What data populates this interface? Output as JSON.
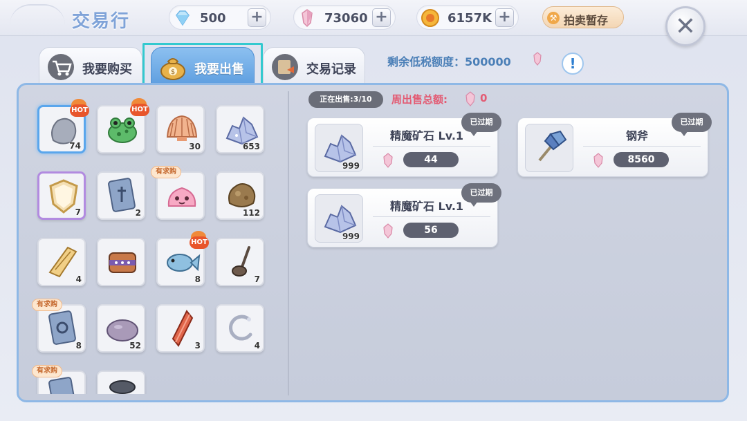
{
  "header": {
    "title": "交易行",
    "currencies": [
      {
        "name": "diamond",
        "icon": "diamond-icon",
        "value": "500"
      },
      {
        "name": "crystal",
        "icon": "crystal-icon",
        "value": "73060"
      },
      {
        "name": "coin",
        "icon": "coin-icon",
        "value": "6157K"
      }
    ],
    "plus_label": "+",
    "auction_label": "拍卖暂存",
    "close_label": "✕"
  },
  "tabs": [
    {
      "label": "我要购买",
      "icon": "cart-icon",
      "active": false
    },
    {
      "label": "我要出售",
      "icon": "money-bag-icon",
      "active": true
    },
    {
      "label": "交易记录",
      "icon": "record-book-icon",
      "active": false
    }
  ],
  "quota": {
    "label": "剩余低税额度：500000",
    "info": "!"
  },
  "inventory": [
    {
      "icon": "stone-icon",
      "count": "74",
      "hot": "HOT",
      "selected": true
    },
    {
      "icon": "frog-icon",
      "count": "",
      "hot": "HOT"
    },
    {
      "icon": "shell-icon",
      "count": "30"
    },
    {
      "icon": "ore-crystal-icon",
      "count": "653"
    },
    {
      "icon": "shield-icon",
      "count": "7",
      "purple": true
    },
    {
      "icon": "card-icon",
      "count": "2"
    },
    {
      "icon": "pink-slime-icon",
      "count": "",
      "req": "有求购"
    },
    {
      "icon": "rock-icon",
      "count": "112"
    },
    {
      "icon": "golden-cloth-icon",
      "count": "4"
    },
    {
      "icon": "crown-icon",
      "count": ""
    },
    {
      "icon": "fish-icon",
      "count": "8",
      "hot": "HOT"
    },
    {
      "icon": "ladle-icon",
      "count": "7"
    },
    {
      "icon": "rune-card-icon",
      "count": "8",
      "req": "有求购"
    },
    {
      "icon": "purple-stone-icon",
      "count": "52"
    },
    {
      "icon": "red-crystal-icon",
      "count": "3"
    },
    {
      "icon": "silver-ring-icon",
      "count": "4"
    },
    {
      "icon": "rune-card-icon",
      "count": "",
      "req": "有求购"
    },
    {
      "icon": "dark-item-icon",
      "count": ""
    }
  ],
  "sale": {
    "on_sale": "正在出售:3/10",
    "weekly_label": "周出售总额:",
    "weekly_value": "0",
    "listings": [
      {
        "name": "精魔矿石 Lv.1",
        "count": "999",
        "price": "44",
        "status": "已过期",
        "icon": "ore-crystal-icon"
      },
      {
        "name": "钢斧",
        "count": "",
        "price": "8560",
        "status": "已过期",
        "icon": "axe-icon"
      },
      {
        "name": "精魔矿石 Lv.1",
        "count": "999",
        "price": "56",
        "status": "已过期",
        "icon": "ore-crystal-icon"
      }
    ]
  },
  "colors": {
    "accent": "#5f9fe0",
    "highlight": "#33c9cf",
    "weekly": "#e35b73"
  }
}
